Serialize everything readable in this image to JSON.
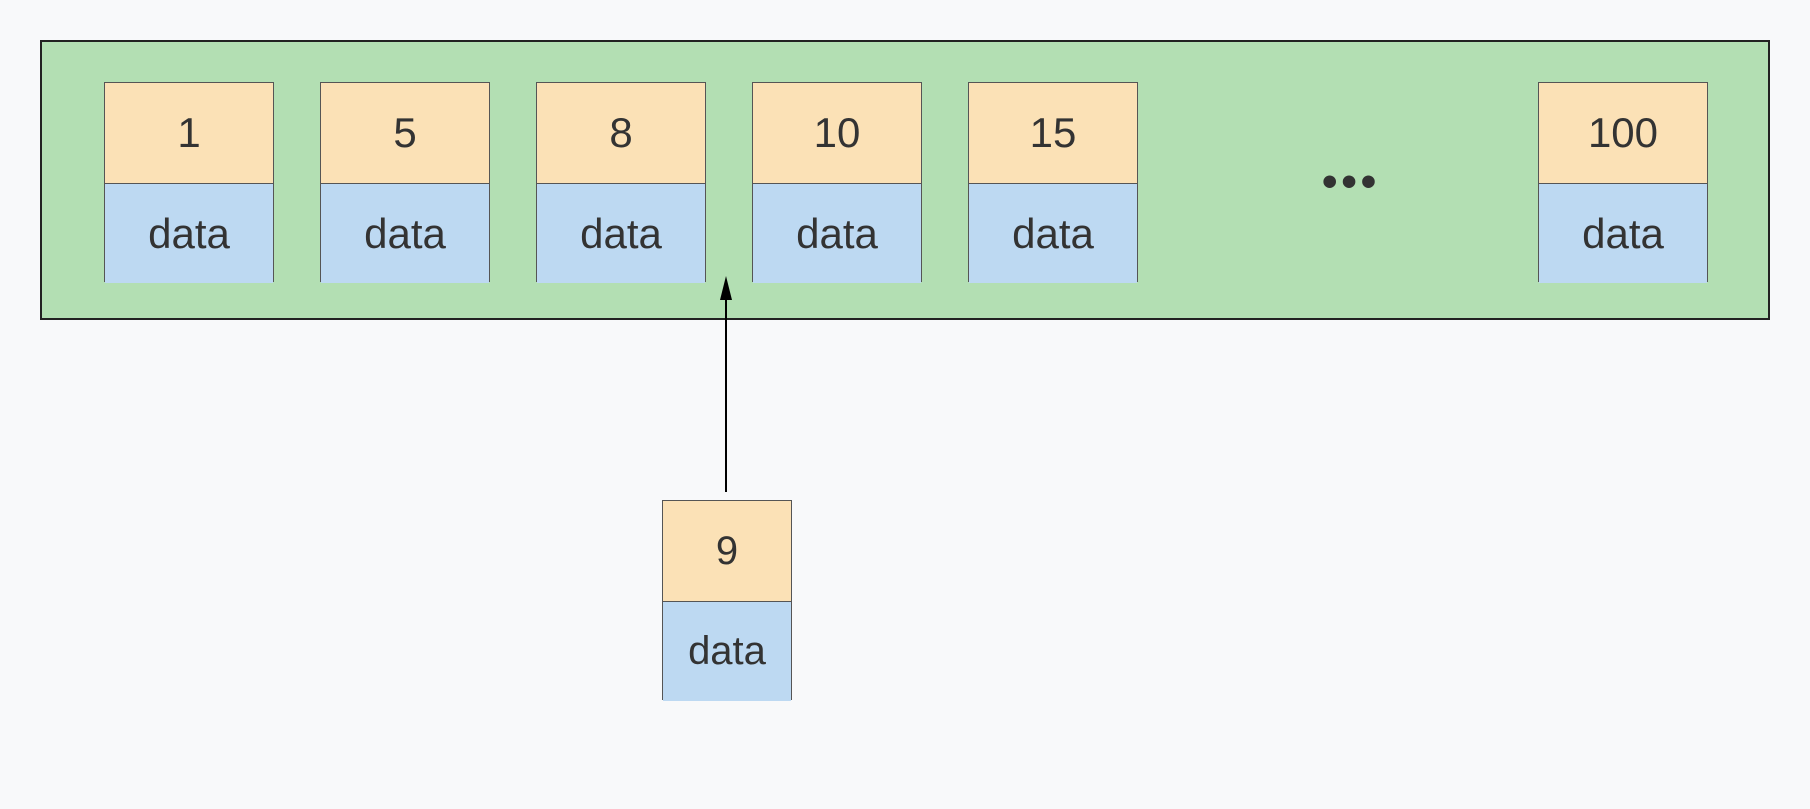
{
  "list": {
    "nodes": [
      {
        "key": "1",
        "data": "data"
      },
      {
        "key": "5",
        "data": "data"
      },
      {
        "key": "8",
        "data": "data"
      },
      {
        "key": "10",
        "data": "data"
      },
      {
        "key": "15",
        "data": "data"
      },
      {
        "key": "100",
        "data": "data"
      }
    ],
    "ellipsis": "•••"
  },
  "insert": {
    "key": "9",
    "data": "data"
  }
}
